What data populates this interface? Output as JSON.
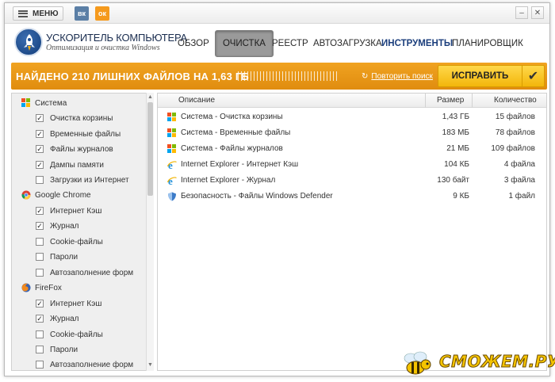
{
  "titlebar": {
    "menu_label": "МЕНЮ",
    "vk_label": "вк",
    "ok_label": "ок",
    "minimize_glyph": "–",
    "close_glyph": "✕"
  },
  "header": {
    "title": "УСКОРИТЕЛЬ КОМПЬЮТЕРА",
    "subtitle": "Оптимизация и очистка Windows",
    "nav": [
      {
        "label": "ОБЗОР"
      },
      {
        "label": "ОЧИСТКА",
        "active": true
      },
      {
        "label": "РЕЕСТР"
      },
      {
        "label": "АВТОЗАГРУЗКА"
      },
      {
        "label": "ИНСТРУМЕНТЫ",
        "highlight": true
      },
      {
        "label": "ПЛАНИРОВЩИК"
      }
    ]
  },
  "status_bar": {
    "found_text": "НАЙДЕНО 210 ЛИШНИХ ФАЙЛОВ НА 1,63 ГБ",
    "repeat_label": "Повторить поиск",
    "fix_label": "ИСПРАВИТЬ",
    "colors": {
      "bar": "#e8961a",
      "button": "#f7c423"
    }
  },
  "tree": {
    "groups": [
      {
        "label": "Система",
        "icon": "windows-icon",
        "items": [
          {
            "label": "Очистка корзины",
            "checked": true
          },
          {
            "label": "Временные файлы",
            "checked": true
          },
          {
            "label": "Файлы журналов",
            "checked": true
          },
          {
            "label": "Дампы памяти",
            "checked": true
          },
          {
            "label": "Загрузки из Интернет",
            "checked": false
          }
        ]
      },
      {
        "label": "Google Chrome",
        "icon": "chrome-icon",
        "items": [
          {
            "label": "Интернет Кэш",
            "checked": true
          },
          {
            "label": "Журнал",
            "checked": true
          },
          {
            "label": "Cookie-файлы",
            "checked": false
          },
          {
            "label": "Пароли",
            "checked": false
          },
          {
            "label": "Автозаполнение форм",
            "checked": false
          }
        ]
      },
      {
        "label": "FireFox",
        "icon": "firefox-icon",
        "items": [
          {
            "label": "Интернет Кэш",
            "checked": true
          },
          {
            "label": "Журнал",
            "checked": true
          },
          {
            "label": "Cookie-файлы",
            "checked": false
          },
          {
            "label": "Пароли",
            "checked": false
          },
          {
            "label": "Автозаполнение форм",
            "checked": false
          }
        ]
      }
    ]
  },
  "table": {
    "columns": {
      "description": "Описание",
      "size": "Размер",
      "count": "Количество"
    },
    "rows": [
      {
        "icon": "windows-icon",
        "description": "Система - Очистка корзины",
        "size": "1,43 ГБ",
        "count": "15 файлов"
      },
      {
        "icon": "windows-icon",
        "description": "Система - Временные файлы",
        "size": "183 МБ",
        "count": "78 файлов"
      },
      {
        "icon": "windows-icon",
        "description": "Система - Файлы журналов",
        "size": "21 МБ",
        "count": "109 файлов"
      },
      {
        "icon": "internet-explorer-icon",
        "description": "Internet Explorer - Интернет Кэш",
        "size": "104 КБ",
        "count": "4 файла"
      },
      {
        "icon": "internet-explorer-icon",
        "description": "Internet Explorer - Журнал",
        "size": "130 байт",
        "count": "3 файла"
      },
      {
        "icon": "shield-icon",
        "description": "Безопасность - Файлы Windows Defender",
        "size": "9 КБ",
        "count": "1 файл"
      }
    ]
  },
  "watermark": {
    "text": "СМОЖЕМ.РУ"
  }
}
